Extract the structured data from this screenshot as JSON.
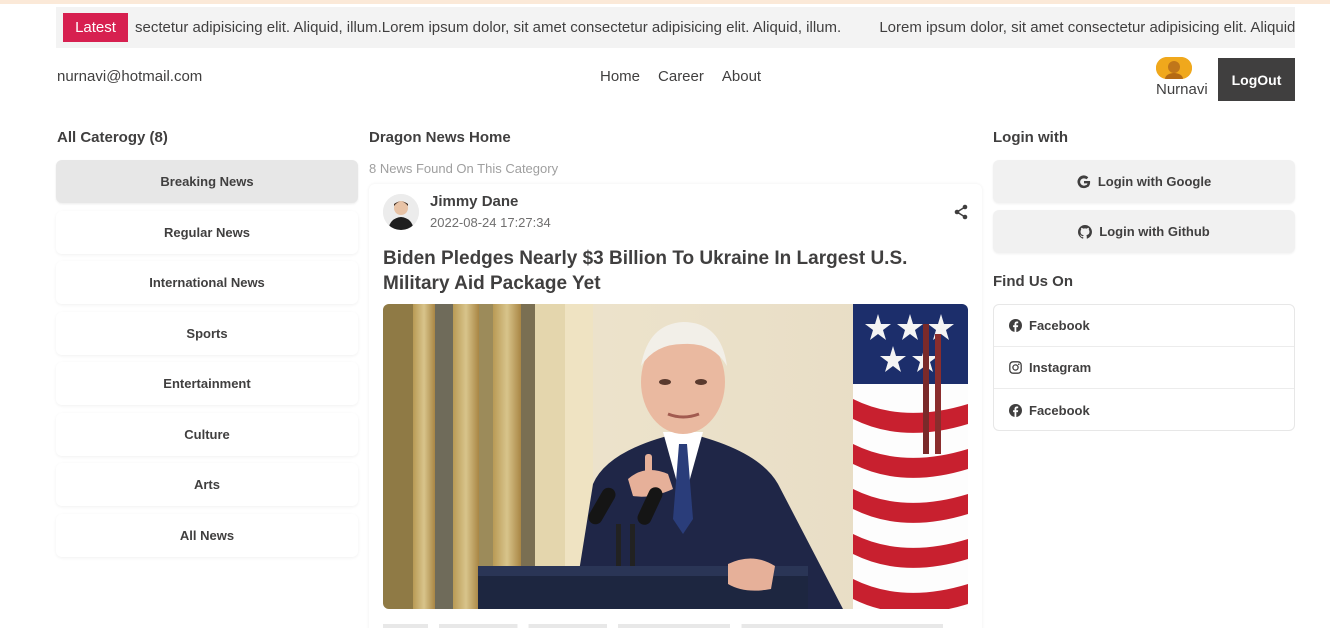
{
  "ticker": {
    "badge": "Latest",
    "items": [
      "sectetur adipisicing elit. Aliquid, illum.Lorem ipsum dolor, sit amet consectetur adipisicing elit. Aliquid, illum.",
      "Lorem ipsum dolor, sit amet consectetur adipisicing elit. Aliquid, illum."
    ]
  },
  "nav": {
    "email": "nurnavi@hotmail.com",
    "links": [
      "Home",
      "Career",
      "About"
    ],
    "user_name": "Nurnavi",
    "logout_label": "LogOut"
  },
  "categories": {
    "title": "All Caterogy (8)",
    "items": [
      "Breaking News",
      "Regular News",
      "International News",
      "Sports",
      "Entertainment",
      "Culture",
      "Arts",
      "All News"
    ],
    "active_index": 0
  },
  "main": {
    "title": "Dragon News Home",
    "found_text": "8 News Found On This Category",
    "article": {
      "author": "Jimmy Dane",
      "date": "2022-08-24 17:27:34",
      "title": "Biden Pledges Nearly $3 Billion To Ukraine In Largest U.S. Military Aid Package Yet"
    }
  },
  "sidebar_right": {
    "login_title": "Login with",
    "google_label": "Login with Google",
    "github_label": "Login with Github",
    "find_title": "Find Us On",
    "social": [
      "Facebook",
      "Instagram",
      "Facebook"
    ]
  },
  "colors": {
    "accent": "#d72050",
    "dark": "#403f3f",
    "muted": "#9f9f9f"
  }
}
